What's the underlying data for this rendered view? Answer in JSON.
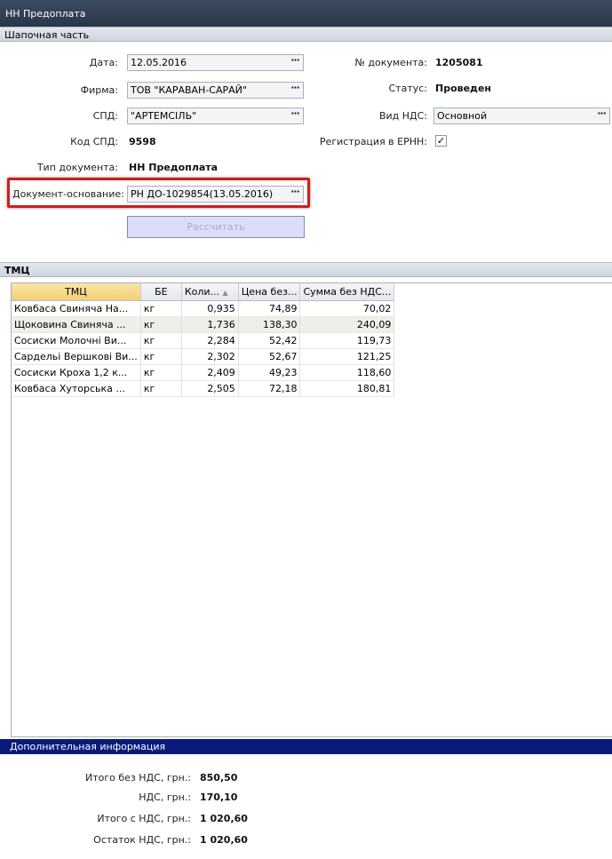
{
  "window": {
    "title": "НН Предоплата"
  },
  "header": {
    "section_title": "Шапочная часть",
    "date": {
      "label": "Дата:",
      "value": "12.05.2016"
    },
    "firm": {
      "label": "Фирма:",
      "value": "ТОВ \"КАРАВАН-САРАЙ\""
    },
    "spd": {
      "label": "СПД:",
      "value": "\"АРТЕМСІЛЬ\""
    },
    "spd_code": {
      "label": "Код СПД:",
      "value": "9598"
    },
    "doc_type": {
      "label": "Тип документа:",
      "value": "НН Предоплата"
    },
    "base_doc": {
      "label": "Документ-основание:",
      "value": "РН ДО-1029854(13.05.2016)"
    },
    "calc_button": "Рассчитать",
    "doc_number": {
      "label": "№ документа:",
      "value": "1205081"
    },
    "status": {
      "label": "Статус:",
      "value": "Проведен"
    },
    "vat_type": {
      "label": "Вид НДС:",
      "value": "Основной"
    },
    "erpn": {
      "label": "Регистрация в ЕРНН:",
      "checked": true,
      "check_glyph": "✓"
    },
    "dots": "···"
  },
  "items": {
    "section_title": "ТМЦ",
    "columns": [
      "ТМЦ",
      "БЕ",
      "Коли...",
      "Цена без...",
      "Сумма без НДС..."
    ],
    "sort_glyph": "▲",
    "rows": [
      [
        "Ковбаса Свиняча На...",
        "кг",
        "0,935",
        "74,89",
        "70,02"
      ],
      [
        "Щоковина Свиняча ...",
        "кг",
        "1,736",
        "138,30",
        "240,09"
      ],
      [
        "Сосиски Молочні Ви...",
        "кг",
        "2,284",
        "52,42",
        "119,73"
      ],
      [
        "Сардельі Вершкові Ви...",
        "кг",
        "2,302",
        "52,67",
        "121,25"
      ],
      [
        "Сосиски Кроха 1,2 к...",
        "кг",
        "2,409",
        "49,23",
        "118,60"
      ],
      [
        "Ковбаса Хуторська ...",
        "кг",
        "2,505",
        "72,18",
        "180,81"
      ]
    ]
  },
  "additional": {
    "section_title": "Дополнительная информация",
    "total_no_vat": {
      "label": "Итого без НДС,  грн.:",
      "value": "850,50"
    },
    "vat": {
      "label": "НДС, грн.:",
      "value": "170,10"
    },
    "total_with_vat": {
      "label": "Итого с НДС, грн.:",
      "value": "1 020,60"
    },
    "vat_remainder": {
      "label": "Остаток НДС, грн.:",
      "value": "1 020,60"
    }
  },
  "colors": {
    "highlight": "#d21c1c",
    "info_bar": "#0a1a7a",
    "selected_header": "#f4cf71"
  }
}
